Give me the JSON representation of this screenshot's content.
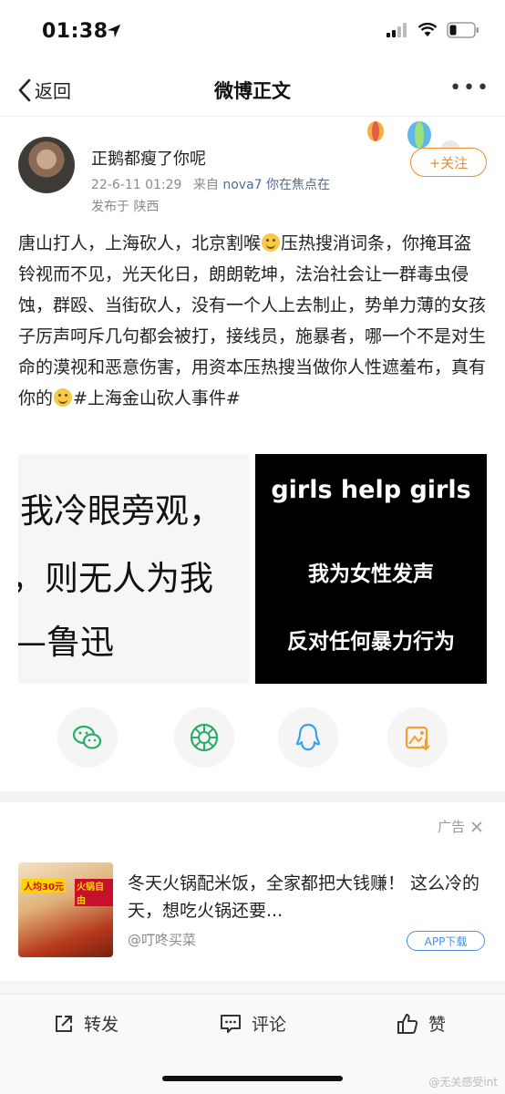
{
  "status_bar": {
    "time": "01:38"
  },
  "nav": {
    "back_label": "返回",
    "title": "微博正文",
    "more_label": "•••"
  },
  "post": {
    "username": "正鹅都瘦了你呢",
    "date": "22-6-11 01:29",
    "source_prefix": "来自",
    "source": "nova7 你在焦点在",
    "location": "发布于 陕西",
    "follow_label": "+关注",
    "text_parts": [
      "唐山打人，上海砍人，北京割喉",
      "压热搜消词条，你掩耳盗铃视而不见，光天化日，朗朗乾坤，法治社会让一群毒虫侵蚀，群殴、当街砍人，没有一个人上去制止，势单力薄的女孩子厉声呵斥几句都会被打，接线员，施暴者，哪一个不是对生命的漠视和恶意伤害，用资本压热搜当做你人性遮羞布，真有你的",
      "#上海金山砍人事件#"
    ],
    "image_left": {
      "line1": "我冷眼旁观，",
      "line2": "，则无人为我",
      "line3": "—鲁迅"
    },
    "image_right": {
      "line1": "girls help girls",
      "line2": "我为女性发声",
      "line3": "反对任何暴力行为"
    }
  },
  "share": {
    "icons": [
      "wechat-icon",
      "moments-icon",
      "qq-icon",
      "save-image-icon"
    ],
    "colors": {
      "wechat": "#2aae67",
      "moments": "#2aae67",
      "qq": "#3aa0f0",
      "save": "#f0a030"
    }
  },
  "ad": {
    "label": "广告",
    "thumb_text1": "人均30元",
    "thumb_text2": "火锅自由",
    "title": "冬天火锅配米饭，全家都把大钱赚！ 这么冷的天，想吃火锅还要...",
    "source": "@叮咚买菜",
    "app_label": "APP下载"
  },
  "actions": {
    "repost": "转发",
    "comment": "评论",
    "like": "赞"
  },
  "watermark": "@无关感受int",
  "colors": {
    "accent": "#f08a2c",
    "link": "#506c97"
  }
}
